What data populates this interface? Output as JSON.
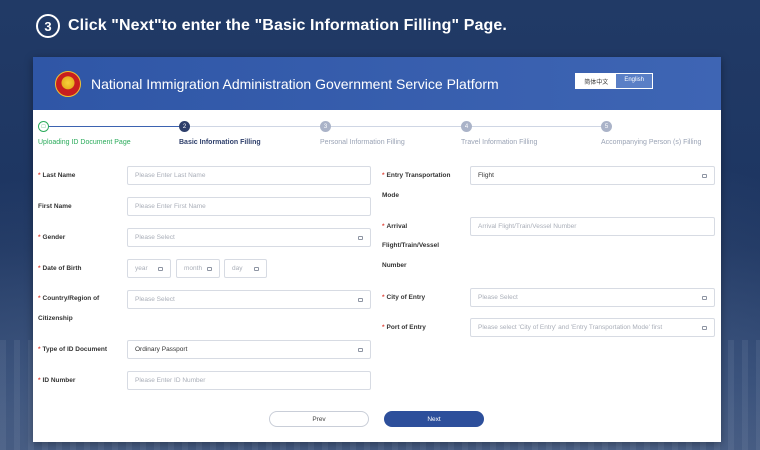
{
  "header": {
    "step_number": "3",
    "instruction": "Click \"Next\"to enter the \"Basic Information Filling\" Page."
  },
  "banner": {
    "title": "National Immigration Administration Government Service Platform",
    "lang_zh": "简体中文",
    "lang_en": "English"
  },
  "steps": [
    {
      "number": "",
      "label": "Uploading ID Document Page",
      "state": "done"
    },
    {
      "number": "2",
      "label": "Basic Information Filling",
      "state": "active"
    },
    {
      "number": "3",
      "label": "Personal Information Filling",
      "state": "todo"
    },
    {
      "number": "4",
      "label": "Travel Information Filling",
      "state": "todo"
    },
    {
      "number": "5",
      "label": "Accompanying Person (s) Filling",
      "state": "todo"
    }
  ],
  "form": {
    "last_name": {
      "label": "Last Name",
      "placeholder": "Please Enter Last Name"
    },
    "first_name": {
      "label": "First Name",
      "placeholder": "Please Enter First Name"
    },
    "gender": {
      "label": "Gender",
      "placeholder": "Please Select"
    },
    "dob": {
      "label": "Date of Birth",
      "year": "year",
      "month": "month",
      "day": "day"
    },
    "country": {
      "label_line1": "Country/Region of",
      "label_line2": "Citizenship",
      "placeholder": "Please Select"
    },
    "id_type": {
      "label": "Type of ID Document",
      "value": "Ordinary Passport"
    },
    "id_number": {
      "label": "ID Number",
      "placeholder": "Please Enter ID Number"
    },
    "transport": {
      "label_line1": "Entry Transportation",
      "label_line2": "Mode",
      "value": "Flight"
    },
    "arrival": {
      "label_line1": "Arrival",
      "label_line2": "Flight/Train/Vessel",
      "label_line3": "Number",
      "placeholder": "Arrival Flight/Train/Vessel Number"
    },
    "city": {
      "label": "City of Entry",
      "placeholder": "Please Select"
    },
    "port": {
      "label": "Port of Entry",
      "placeholder": "Please select 'City of Entry' and 'Entry Transportation Mode' first"
    }
  },
  "buttons": {
    "prev": "Prev",
    "next": "Next"
  },
  "colors": {
    "accent": "#2d4f9b",
    "banner": "#3e65b4",
    "done": "#2bab5b",
    "required": "#e0453a"
  }
}
